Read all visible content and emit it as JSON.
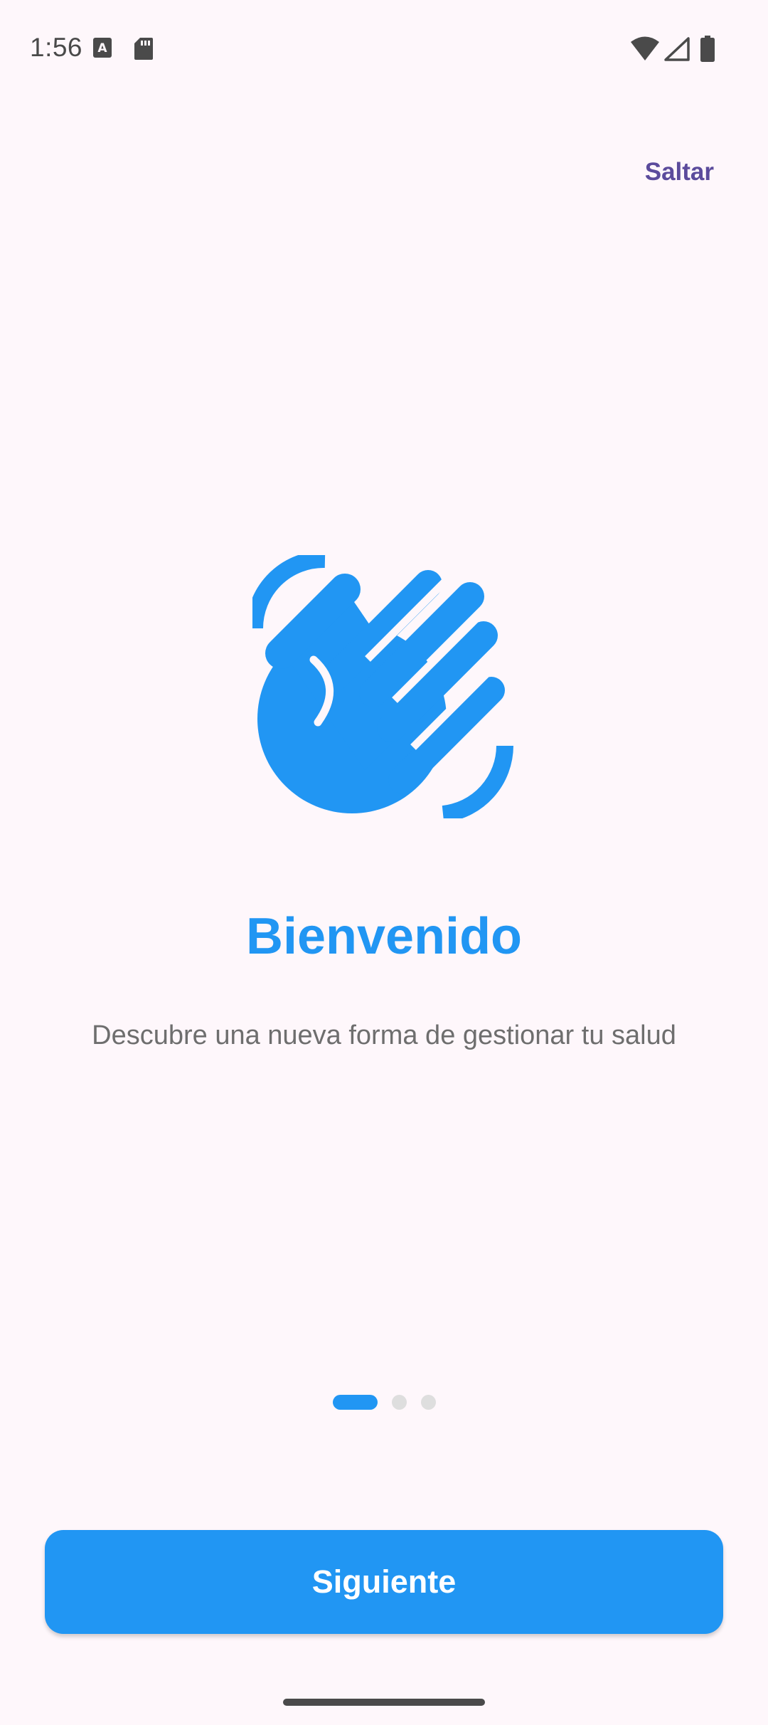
{
  "status_bar": {
    "time": "1:56",
    "icons": [
      "keyboard-a-icon",
      "sd-card-icon",
      "wifi-icon",
      "signal-icon",
      "battery-icon"
    ]
  },
  "header": {
    "skip_label": "Saltar"
  },
  "onboarding": {
    "icon": "waving-hand-icon",
    "title": "Bienvenido",
    "subtitle": "Descubre una nueva forma de gestionar tu salud",
    "current_page": 1,
    "total_pages": 3
  },
  "footer": {
    "next_label": "Siguiente"
  },
  "colors": {
    "accent": "#2196f3",
    "skip_text": "#5b4b9c",
    "background": "#fef7fb",
    "subtitle_text": "#6e6e6e",
    "dot_inactive": "#dedede"
  }
}
